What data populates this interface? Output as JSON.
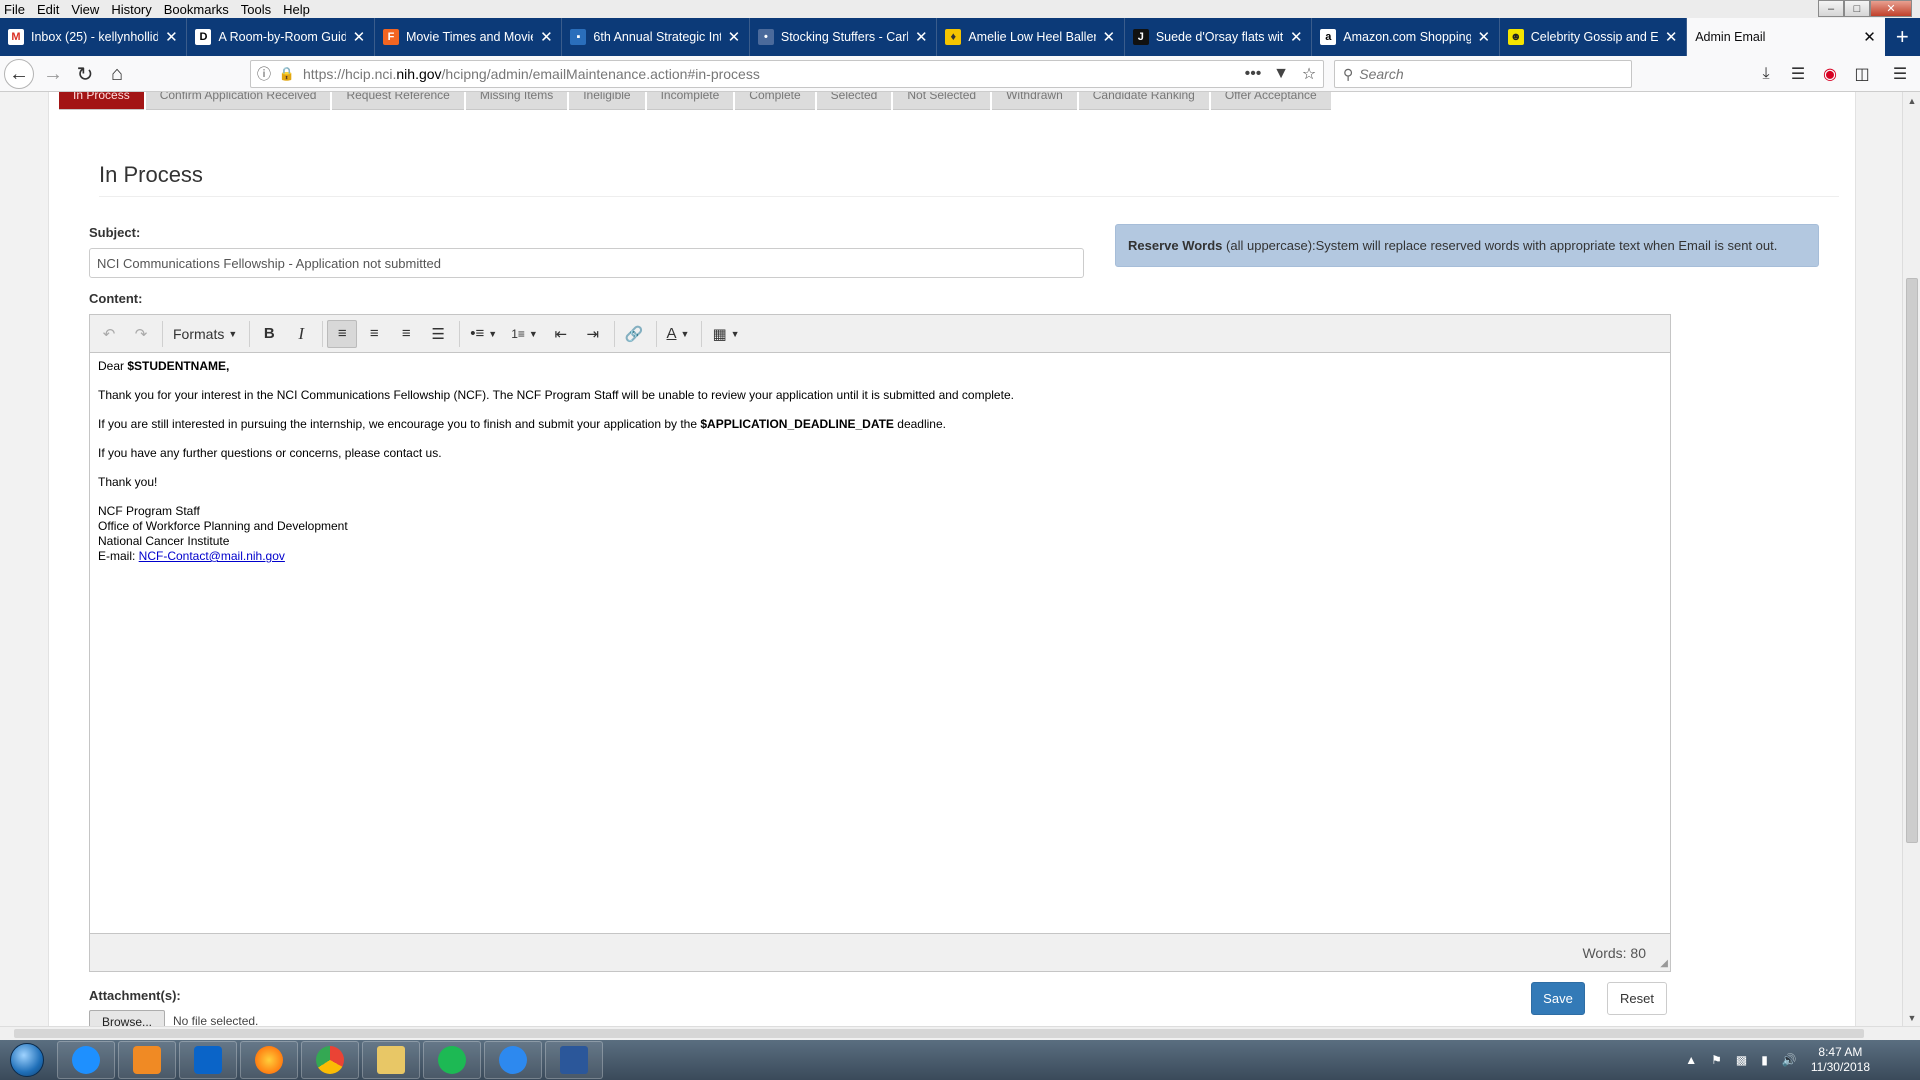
{
  "menubar": {
    "items": [
      "File",
      "Edit",
      "View",
      "History",
      "Bookmarks",
      "Tools",
      "Help"
    ]
  },
  "tabs": [
    {
      "label": "Inbox (25) - kellynhollid",
      "icon": "gmail-icon",
      "color": "#d93025",
      "glyph": "M"
    },
    {
      "label": "A Room-by-Room Guid",
      "icon": "d-icon",
      "color": "#ffffff",
      "glyph": "D"
    },
    {
      "label": "Movie Times and Movie",
      "icon": "fandango-icon",
      "color": "#f26522",
      "glyph": "F"
    },
    {
      "label": "6th Annual Strategic Int",
      "icon": "page-icon",
      "color": "#2a6ebb",
      "glyph": "▪"
    },
    {
      "label": "Stocking Stuffers - Carly",
      "icon": "page-icon",
      "color": "#4b6a9b",
      "glyph": "•"
    },
    {
      "label": "Amelie Low Heel Ballerin",
      "icon": "page-icon",
      "color": "#f5c400",
      "glyph": "♦"
    },
    {
      "label": "Suede d'Orsay flats with",
      "icon": "j-icon",
      "color": "#111111",
      "glyph": "J"
    },
    {
      "label": "Amazon.com Shopping",
      "icon": "amazon-icon",
      "color": "#ffffff",
      "glyph": "a"
    },
    {
      "label": "Celebrity Gossip and Ent",
      "icon": "page-icon",
      "color": "#f5e400",
      "glyph": "☻"
    },
    {
      "label": "Admin Email",
      "icon": "none",
      "color": "",
      "glyph": ""
    }
  ],
  "address": {
    "url_prefix": "https://hcip.nci.",
    "url_domain": "nih.gov",
    "url_path": "/hcipng/admin/emailMaintenance.action#in-process",
    "more": "•••",
    "search_placeholder": "Search"
  },
  "status_tabs": [
    "In Process",
    "Confirm Application Received",
    "Request Reference",
    "Missing Items",
    "Ineligible",
    "Incomplete",
    "Complete",
    "Selected",
    "Not Selected",
    "Withdrawn",
    "Candidate Ranking",
    "Offer Acceptance"
  ],
  "page": {
    "title": "In Process",
    "subject_label": "Subject:",
    "subject_value": "NCI Communications Fellowship - Application not submitted",
    "content_label": "Content:",
    "reserve_bold": "Reserve Words",
    "reserve_text": " (all uppercase):System will replace reserved words with appropriate text when Email is sent out."
  },
  "editor": {
    "formats_label": "Formats",
    "body": {
      "greeting_prefix": "Dear ",
      "greeting_token": "$STUDENTNAME,",
      "p1": "Thank you for your interest in the NCI Communications Fellowship (NCF). The NCF Program Staff will be unable to review your application until it is submitted and complete.",
      "p2_before": "If you are still interested in pursuing the internship, we encourage you to finish and submit your application by the ",
      "p2_token": "$APPLICATION_DEADLINE_DATE",
      "p2_after": " deadline.",
      "p3": "If you have any further questions or concerns, please contact us.",
      "p4": "Thank you!",
      "sig1": "NCF Program Staff",
      "sig2": "Office of Workforce Planning and Development",
      "sig3": "National Cancer Institute",
      "sig_email_label": "E-mail: ",
      "sig_email": "NCF-Contact@mail.nih.gov"
    },
    "word_count": "Words: 80"
  },
  "attachments": {
    "label": "Attachment(s):",
    "browse_label": "Browse...",
    "no_file": "No file selected."
  },
  "actions": {
    "save_label": "Save",
    "reset_label": "Reset"
  },
  "taskbar": {
    "apps": [
      {
        "name": "ie-icon",
        "color": "#1e90ff"
      },
      {
        "name": "media-player-icon",
        "color": "#f08a24"
      },
      {
        "name": "outlook-icon",
        "color": "#0a64c8"
      },
      {
        "name": "firefox-icon",
        "color": "#ff7a00"
      },
      {
        "name": "chrome-icon",
        "color": "#34a853"
      },
      {
        "name": "file-explorer-icon",
        "color": "#e8c766"
      },
      {
        "name": "spotify-icon",
        "color": "#1db954"
      },
      {
        "name": "chat-icon",
        "color": "#2d89ef"
      },
      {
        "name": "word-icon",
        "color": "#2b579a"
      }
    ],
    "time": "8:47 AM",
    "date": "11/30/2018"
  },
  "colors": {
    "accent": "#337ab7",
    "status_active": "#a31515",
    "reserve_bg": "#b3c8e0",
    "tabbar": "#0c3a78"
  }
}
